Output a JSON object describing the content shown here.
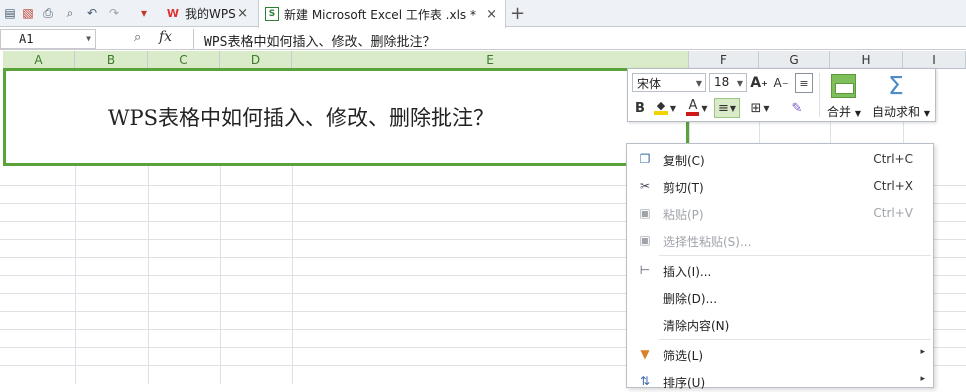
{
  "tabs": {
    "wps": {
      "label": "我的WPS",
      "close": "×"
    },
    "excel": {
      "label": "新建 Microsoft Excel 工作表 .xls *",
      "close": "×"
    },
    "new_tab": "+"
  },
  "formula_bar": {
    "cell_ref": "A1",
    "fx": "fx",
    "formula": "WPS表格中如何插入、修改、删除批注？"
  },
  "columns": [
    "A",
    "B",
    "C",
    "D",
    "E",
    "F",
    "G",
    "H",
    "I"
  ],
  "cell_a1": "WPS表格中如何插入、修改、删除批注？",
  "mini_toolbar": {
    "font": "宋体",
    "size": "18",
    "grow": "A",
    "shrink": "A",
    "bold": "B",
    "merge_label": "合并",
    "sum_label": "自动求和",
    "sum_symbol": "Σ",
    "colors": {
      "fill": "#f2d200",
      "font": "#d11818"
    }
  },
  "context_menu": [
    {
      "label": "复制(C)",
      "shortcut": "Ctrl+C",
      "icon": "copy-icon",
      "enabled": true
    },
    {
      "label": "剪切(T)",
      "shortcut": "Ctrl+X",
      "icon": "scissors-icon",
      "enabled": true
    },
    {
      "label": "粘贴(P)",
      "shortcut": "Ctrl+V",
      "icon": "paste-icon",
      "enabled": false
    },
    {
      "label": "选择性粘贴(S)...",
      "shortcut": "",
      "icon": "paste-special-icon",
      "enabled": false
    },
    {
      "label": "插入(I)...",
      "shortcut": "",
      "icon": "insert-icon",
      "enabled": true
    },
    {
      "label": "删除(D)...",
      "shortcut": "",
      "icon": "",
      "enabled": true
    },
    {
      "label": "清除内容(N)",
      "shortcut": "",
      "icon": "",
      "enabled": true
    },
    {
      "label": "筛选(L)",
      "shortcut": "",
      "icon": "filter-icon",
      "enabled": true,
      "submenu": true
    },
    {
      "label": "排序(U)",
      "shortcut": "",
      "icon": "sort-icon",
      "enabled": true,
      "submenu": true
    }
  ],
  "accent_color": "#5aa33a"
}
